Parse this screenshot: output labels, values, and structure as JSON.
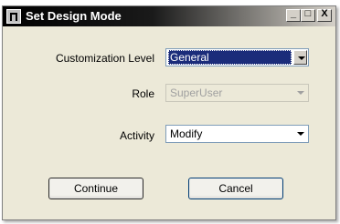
{
  "window": {
    "title": "Set Design Mode",
    "icon": "app-icon",
    "controls": {
      "minimize_glyph": "_",
      "maximize_glyph": "□",
      "close_glyph": "X"
    }
  },
  "form": {
    "customization_level": {
      "label": "Customization Level",
      "value": "General"
    },
    "role": {
      "label": "Role",
      "value": "SuperUser"
    },
    "activity": {
      "label": "Activity",
      "value": "Modify"
    }
  },
  "buttons": {
    "continue_label": "Continue",
    "cancel_label": "Cancel"
  },
  "colors": {
    "title_bar": "#000000",
    "selection": "#1b2c7a",
    "dialog_face": "#ece9d8"
  }
}
